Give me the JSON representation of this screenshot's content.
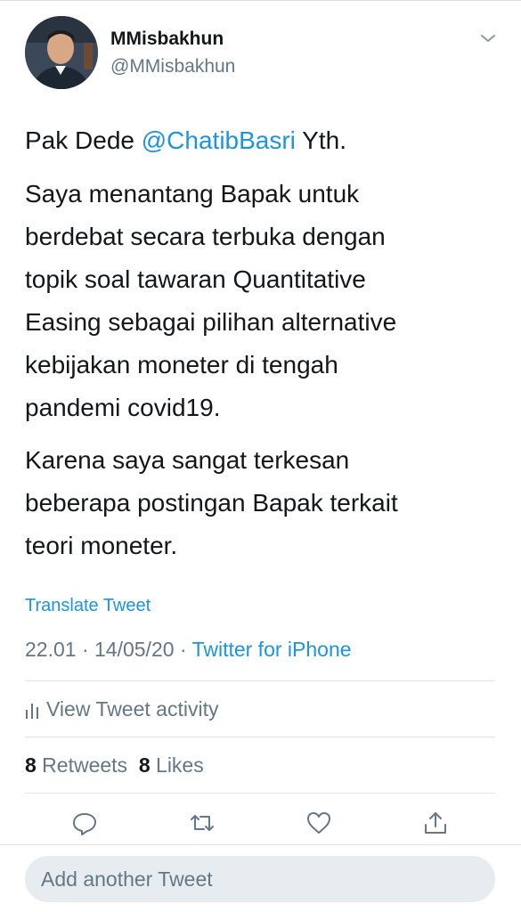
{
  "author": {
    "display_name": "MMisbakhun",
    "username": "@MMisbakhun"
  },
  "tweet": {
    "p1_prefix": "Pak Dede ",
    "p1_mention": "@ChatibBasri",
    "p1_suffix": " Yth.",
    "p2_lines": [
      "Saya menantang Bapak untuk",
      "berdebat secara terbuka dengan",
      "topik soal tawaran Quantitative",
      "Easing sebagai pilihan alternative",
      "kebijakan moneter di tengah",
      "pandemi covid19."
    ],
    "p3_lines": [
      "Karena saya sangat terkesan",
      "beberapa postingan Bapak terkait",
      "teori moneter."
    ]
  },
  "translate_label": "Translate Tweet",
  "meta": {
    "time_date": "22.01 · 14/05/20 · ",
    "source": "Twitter for iPhone"
  },
  "activity_label": "View Tweet activity",
  "stats": {
    "retweets_count": "8",
    "retweets_label": " Retweets",
    "likes_count": "8",
    "likes_label": " Likes"
  },
  "action_icons": [
    "reply-icon",
    "retweet-icon",
    "like-icon",
    "share-icon"
  ],
  "compose_placeholder": "Add another Tweet",
  "colors": {
    "link": "#1b95e0",
    "secondary": "#657786",
    "primary_text": "#14171a",
    "divider": "#e1e8ed"
  }
}
